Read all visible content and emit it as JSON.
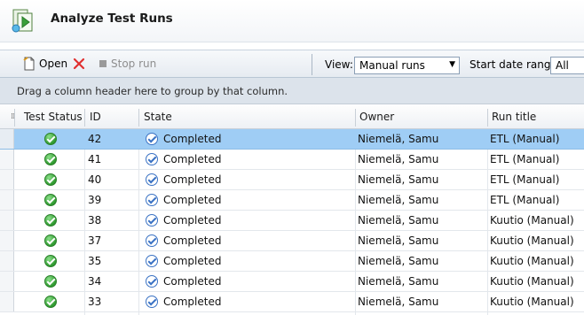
{
  "page": {
    "title": "Analyze Test Runs"
  },
  "toolbar": {
    "open_label": "Open",
    "stop_label": "Stop run",
    "view_label": "View:",
    "view_value": "Manual runs",
    "start_label": "Start date range:",
    "start_value": "All"
  },
  "group_prompt": "Drag a column header here to group by that column.",
  "columns": [
    "Test Status",
    "ID",
    "State",
    "Owner",
    "Run title"
  ],
  "rows": [
    {
      "id": "42",
      "state": "Completed",
      "owner": "Niemelä, Samu",
      "title": "ETL (Manual)"
    },
    {
      "id": "41",
      "state": "Completed",
      "owner": "Niemelä, Samu",
      "title": "ETL (Manual)"
    },
    {
      "id": "40",
      "state": "Completed",
      "owner": "Niemelä, Samu",
      "title": "ETL (Manual)"
    },
    {
      "id": "39",
      "state": "Completed",
      "owner": "Niemelä, Samu",
      "title": "ETL (Manual)"
    },
    {
      "id": "38",
      "state": "Completed",
      "owner": "Niemelä, Samu",
      "title": "Kuutio (Manual)"
    },
    {
      "id": "37",
      "state": "Completed",
      "owner": "Niemelä, Samu",
      "title": "Kuutio (Manual)"
    },
    {
      "id": "35",
      "state": "Completed",
      "owner": "Niemelä, Samu",
      "title": "Kuutio (Manual)"
    },
    {
      "id": "34",
      "state": "Completed",
      "owner": "Niemelä, Samu",
      "title": "Kuutio (Manual)"
    },
    {
      "id": "33",
      "state": "Completed",
      "owner": "Niemelä, Samu",
      "title": "Kuutio (Manual)"
    }
  ],
  "selected_row": 0,
  "colors": {
    "selection": "#9fcdf5",
    "passed": "#2f9a2f",
    "state_icon": "#3a72c4",
    "delete": "#e03030"
  },
  "icons": [
    "test-runs-app-icon",
    "open-document-icon",
    "delete-x-icon",
    "stop-square-icon",
    "dropdown-arrow-icon",
    "passed-check-icon",
    "completed-state-icon"
  ]
}
